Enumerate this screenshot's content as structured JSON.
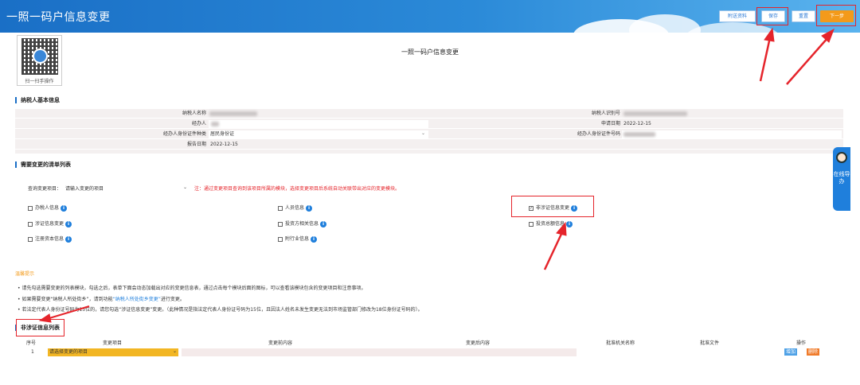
{
  "header": {
    "title": "一照一码户信息变更",
    "buttons": {
      "attachments": "附送资料",
      "save": "保存",
      "reset": "重置",
      "next": "下一步"
    }
  },
  "qr": {
    "caption": "扫一扫手操作"
  },
  "page_title": "一照一码户信息变更",
  "basic_info": {
    "section_title": "纳税人基本信息",
    "taxpayer_name_label": "纳税人名称",
    "taxpayer_id_label": "纳税人识别号",
    "agent_label": "经办人",
    "apply_date_label": "申请日期",
    "apply_date_value": "2022-12-15",
    "id_type_label": "经办人身份证件种类",
    "id_type_value": "居民身份证",
    "id_number_label": "经办人身份证件号码",
    "report_date_label": "报告日期",
    "report_date_value": "2022-12-15"
  },
  "change_list": {
    "section_title": "需要变更的清单列表",
    "query_label": "查询变更项目：",
    "query_placeholder": "请输入变更的项目",
    "note": "注：通过变更项目查询到该项目所属的模块，选择变更项目后系统自动关联带出对应的变更模块。",
    "items": [
      {
        "label": "办税人信息",
        "checked": false
      },
      {
        "label": "人员信息",
        "checked": false
      },
      {
        "label": "非涉证信息变更",
        "checked": true
      },
      {
        "label": "涉证信息变更",
        "checked": false
      },
      {
        "label": "投资方相关信息",
        "checked": false
      },
      {
        "label": "投资总额信息",
        "checked": false
      },
      {
        "label": "注册资本信息",
        "checked": false
      },
      {
        "label": "附行业信息",
        "checked": false
      }
    ]
  },
  "tips": {
    "title": "温馨提示",
    "line1": "请先勾选需要变更的列表模块，勾选之后，表单下面会动态加载出对应的变更信息表，通过点击每个模块后面的图标，可以查看该模块包含的变更项目和注意事项。",
    "line2_prefix": "如果需要变更“纳税人所处街乡”，请到功能",
    "line2_link": "“纳税人所处街乡变更”",
    "line2_suffix": "进行变更。",
    "line3": "若法定代表人身份证号码为15位的，请您勾选“涉证信息变更”变更。（此种情况是指法定代表人身份证号码为15位，且因法人姓名未发生变更无法到市场监管部门修改为18位身份证号码的）。"
  },
  "table": {
    "section_title": "非涉证信息列表",
    "headers": [
      "序号",
      "变更项目",
      "变更前内容",
      "变更后内容",
      "批准机关名称",
      "批准文件",
      "操作"
    ],
    "row": {
      "index": "1",
      "select_value": "请选择变更的项目",
      "add": "增加",
      "delete": "删除"
    }
  },
  "side_widget": {
    "label": "在线导办"
  },
  "colors": {
    "header": "#1a6fc6",
    "accent_orange": "#f39a1a",
    "annotation_red": "#e5242b",
    "link_blue": "#1f7fdc"
  }
}
